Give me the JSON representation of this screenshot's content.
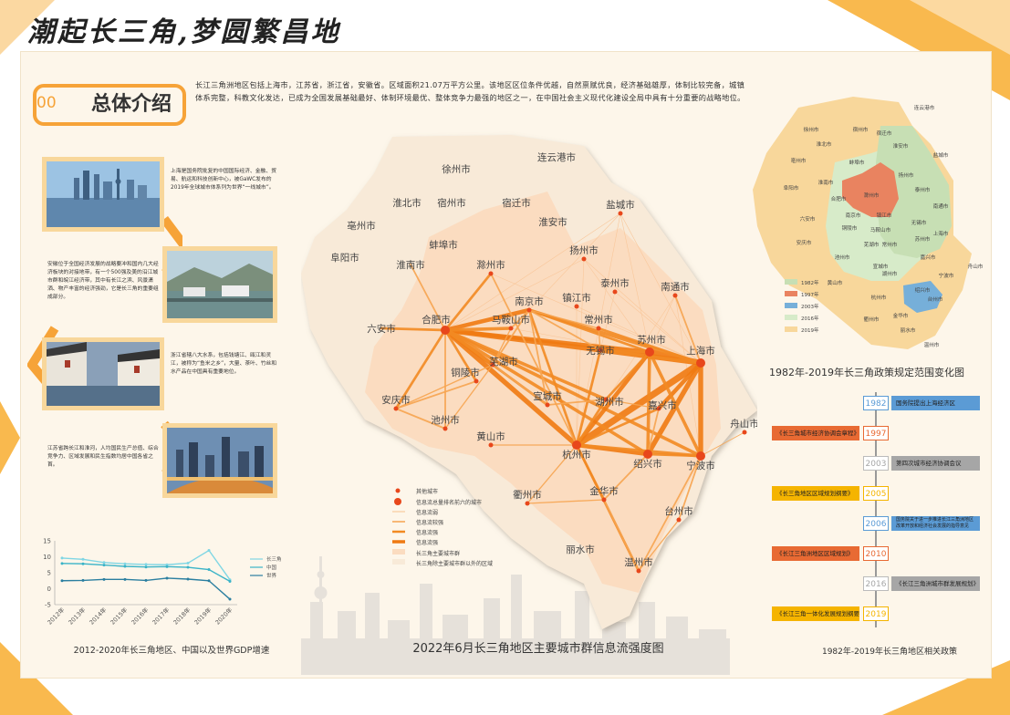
{
  "title": "潮起长三角,梦圆繁昌地",
  "intro": {
    "number": "00",
    "label": "总体介绍",
    "text": "长江三角洲地区包括上海市，江苏省，浙江省，安徽省。区域面积21.07万平方公里。该地区区位条件优越，自然禀赋优良，经济基础雄厚，体制比较完备，城镇体系完整，科教文化发达，已成为全国发展基础最好、体制环境最优、整体竞争力最强的地区之一，在中国社会主义现代化建设全局中具有十分重要的战略地位。"
  },
  "cards": [
    {
      "caption": "上海是国务院批复的中国国际经济、金融、贸易、航运和科技创新中心，被GaWC发布的2019年全球城市体系列为世界“一线城市”。"
    },
    {
      "caption": "安徽位于全国经济发展的战略要冲和国内几大经济板块的对接地带，有一个500强及美的沿江城市群和皖江经济带，其中有长江之滨、风景潇洒、物产丰富的经济强劲，它是长三角的重要组成部分。"
    },
    {
      "caption": "浙江省辖八大水系，包括钱塘江、瓯江和灵江，被称为“鱼米之乡”，大量、茶叶、竹丝和水产品在中国具有重要地位。"
    },
    {
      "caption": "江苏省跨长江和淮河，人均国民生产总值、综合竞争力、区域发展和民生指数均居中国各省之首。"
    }
  ],
  "map": {
    "title": "2022年6月长三角地区主要城市群信息流强度图",
    "cities": [
      {
        "name": "连云港市"
      },
      {
        "name": "徐州市"
      },
      {
        "name": "淮北市"
      },
      {
        "name": "宿州市"
      },
      {
        "name": "宿迁市"
      },
      {
        "name": "盐城市"
      },
      {
        "name": "亳州市"
      },
      {
        "name": "淮安市"
      },
      {
        "name": "蚌埠市"
      },
      {
        "name": "阜阳市"
      },
      {
        "name": "淮南市"
      },
      {
        "name": "扬州市"
      },
      {
        "name": "滁州市"
      },
      {
        "name": "泰州市"
      },
      {
        "name": "南京市"
      },
      {
        "name": "镇江市"
      },
      {
        "name": "南通市"
      },
      {
        "name": "六安市"
      },
      {
        "name": "合肥市"
      },
      {
        "name": "马鞍山市"
      },
      {
        "name": "常州市"
      },
      {
        "name": "苏州市"
      },
      {
        "name": "无锡市"
      },
      {
        "name": "上海市"
      },
      {
        "name": "芜湖市"
      },
      {
        "name": "铜陵市"
      },
      {
        "name": "宣城市"
      },
      {
        "name": "湖州市"
      },
      {
        "name": "嘉兴市"
      },
      {
        "name": "安庆市"
      },
      {
        "name": "池州市"
      },
      {
        "name": "舟山市"
      },
      {
        "name": "黄山市"
      },
      {
        "name": "杭州市"
      },
      {
        "name": "绍兴市"
      },
      {
        "name": "宁波市"
      },
      {
        "name": "金华市"
      },
      {
        "name": "衢州市"
      },
      {
        "name": "台州市"
      },
      {
        "name": "丽水市"
      },
      {
        "name": "温州市"
      }
    ],
    "legend": [
      "其他城市",
      "信息流总量排名前六的城市",
      "信息流弱",
      "信息流较强",
      "信息流强",
      "信息流强",
      "长三角主要城市群",
      "长三角除主要城市群以外的区域"
    ]
  },
  "mini_map": {
    "title": "1982年-2019年长三角政策规定范围变化图",
    "legend": [
      {
        "label": "1982年",
        "color": "#c7dfb4"
      },
      {
        "label": "1997年",
        "color": "#e98360"
      },
      {
        "label": "2003年",
        "color": "#76afd9"
      },
      {
        "label": "2016年",
        "color": "#d7ebc9"
      },
      {
        "label": "2019年",
        "color": "#f8d79b"
      }
    ],
    "labels": [
      "连云港市",
      "宿州市",
      "徐州市",
      "淮北市",
      "亳州市",
      "阜阳市",
      "淮南市",
      "蚌埠市",
      "滁州市",
      "合肥市",
      "六安市",
      "安庆市",
      "池州市",
      "铜陵市",
      "芜湖市",
      "马鞍山市",
      "宣城市",
      "黄山市",
      "南京市",
      "镇江市",
      "扬州市",
      "泰州市",
      "常州市",
      "无锡市",
      "苏州市",
      "南通市",
      "盐城市",
      "淮安市",
      "宿迁市",
      "上海市",
      "湖州市",
      "嘉兴市",
      "杭州市",
      "绍兴市",
      "宁波市",
      "舟山市",
      "衢州市",
      "金华市",
      "台州市",
      "丽水市",
      "温州市"
    ]
  },
  "timeline": {
    "title": "1982年-2019年长三角地区相关政策",
    "items": [
      {
        "year": "1982",
        "text": "国务院提出上海经济区",
        "side": "right",
        "color": "#5b9bd5"
      },
      {
        "year": "1997",
        "text": "《长三角城市经济协调会章程》",
        "side": "left",
        "color": "#e86a33"
      },
      {
        "year": "2003",
        "text": "第四次城市经济协调会议",
        "side": "right",
        "color": "#a6a6a6"
      },
      {
        "year": "2005",
        "text": "《长三角地区区域规划纲要》",
        "side": "left",
        "color": "#f5b400"
      },
      {
        "year": "2006",
        "text": "国务院关于进一步推进长江三角洲地区改革开放和经济社会发展的指导意见",
        "side": "right",
        "color": "#5b9bd5"
      },
      {
        "year": "2010",
        "text": "《长江三角洲地区区域规划》",
        "side": "left",
        "color": "#e86a33"
      },
      {
        "year": "2016",
        "text": "《长江三角洲城市群发展规划》",
        "side": "right",
        "color": "#a6a6a6"
      },
      {
        "year": "2019",
        "text": "《长江三角一体化发展规划纲要》",
        "side": "left",
        "color": "#f5b400"
      }
    ]
  },
  "chart_data": {
    "type": "line",
    "title": "2012-2020年长三角地区、中国以及世界GDP增速",
    "categories": [
      "2012年",
      "2013年",
      "2014年",
      "2015年",
      "2016年",
      "2017年",
      "2018年",
      "2019年",
      "2020年"
    ],
    "ylim": [
      -5,
      15
    ],
    "yticks": [
      "15",
      "10",
      "5",
      "0",
      "-5"
    ],
    "series": [
      {
        "name": "长三角",
        "values": [
          9.6,
          9.2,
          8.2,
          7.8,
          7.6,
          7.5,
          8.0,
          12.0,
          2.8
        ],
        "color": "#7fd6e4"
      },
      {
        "name": "中国",
        "values": [
          7.9,
          7.8,
          7.4,
          7.0,
          6.8,
          6.9,
          6.7,
          6.0,
          2.3
        ],
        "color": "#3ab3c7"
      },
      {
        "name": "世界",
        "values": [
          2.5,
          2.6,
          2.9,
          2.9,
          2.6,
          3.3,
          3.0,
          2.5,
          -3.3
        ],
        "color": "#2b7fa0"
      }
    ]
  }
}
